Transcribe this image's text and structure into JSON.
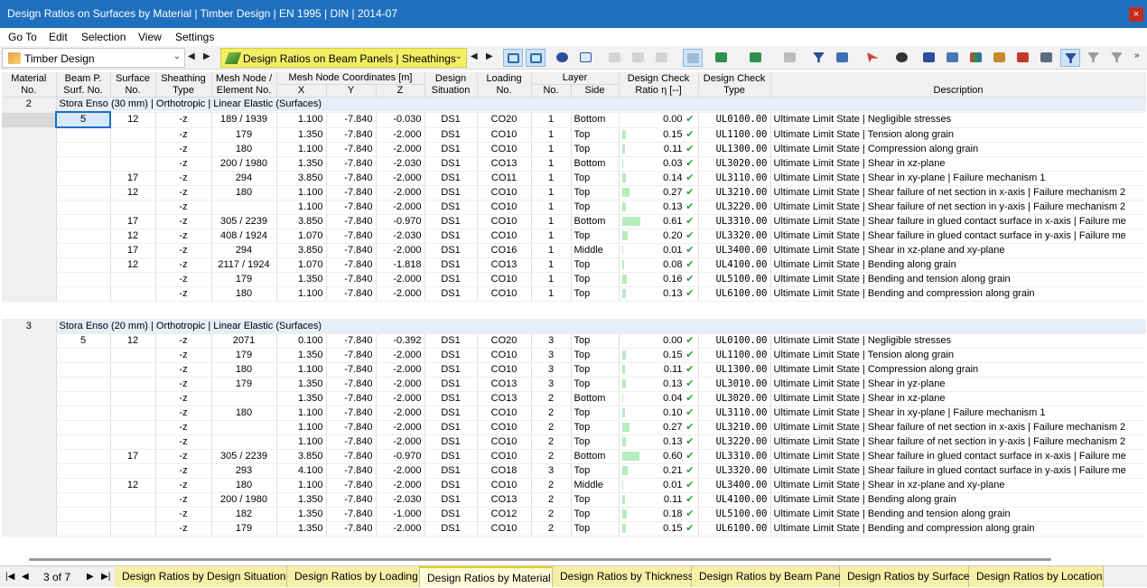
{
  "window": {
    "title": "Design Ratios on Surfaces by Material | Timber Design | EN 1995 | DIN | 2014-07",
    "close_label": "×"
  },
  "menu": [
    "Go To",
    "Edit",
    "Selection",
    "View",
    "Settings"
  ],
  "toolbar": {
    "module_combo": "Timber Design",
    "view_combo": "Design Ratios on Beam Panels | Sheathings",
    "icons": [
      "select-in-model-icon",
      "jump-to-object-icon",
      "view-visibility-icon",
      "xxx-values-icon",
      "table-1-icon",
      "table-2-icon",
      "table-3-icon",
      "align-icon",
      "export-excel-icon",
      "import-excel-icon",
      "print-icon",
      "filter-icon",
      "decimal-icon",
      "cursor-x-icon",
      "help-icon",
      "info-list-icon",
      "layers-icon",
      "color-scale-icon",
      "stack-icon",
      "diagram-icon",
      "relations-icon",
      "filter-active-icon",
      "filter-clear-icon",
      "filter-more-icon"
    ]
  },
  "headers": {
    "material_no": [
      "Material",
      "No."
    ],
    "beam_surf": [
      "Beam P.",
      "Surf. No."
    ],
    "surface_no": [
      "Surface",
      "No."
    ],
    "sheathing": [
      "Sheathing",
      "Type"
    ],
    "mesh": [
      "Mesh Node /",
      "Element No."
    ],
    "coords": "Mesh Node Coordinates [m]",
    "x": "X",
    "y": "Y",
    "z": "Z",
    "design_sit": [
      "Design",
      "Situation"
    ],
    "loading": [
      "Loading",
      "No."
    ],
    "layer": "Layer",
    "layer_no": "No.",
    "layer_side": "Side",
    "ratio": [
      "Design Check",
      "Ratio η [--]"
    ],
    "check_type": [
      "Design Check",
      "Type"
    ],
    "description": "Description"
  },
  "groups": [
    {
      "material": "2",
      "title": "Stora Enso (30 mm) | Orthotropic | Linear Elastic (Surfaces)",
      "rows": [
        {
          "beam": "5",
          "surf": "12",
          "sheath": "-z",
          "mesh": "189 / 1939",
          "x": "1.100",
          "y": "-7.840",
          "z": "-0.030",
          "ds": "DS1",
          "load": "CO20",
          "lno": "1",
          "side": "Bottom",
          "ratio": "0.00",
          "type": "UL0100.00",
          "desc": "Ultimate Limit State | Negligible stresses"
        },
        {
          "beam": "",
          "surf": "",
          "sheath": "-z",
          "mesh": "179",
          "x": "1.350",
          "y": "-7.840",
          "z": "-2.000",
          "ds": "DS1",
          "load": "CO10",
          "lno": "1",
          "side": "Top",
          "ratio": "0.15",
          "type": "UL1100.00",
          "desc": "Ultimate Limit State | Tension along grain"
        },
        {
          "beam": "",
          "surf": "",
          "sheath": "-z",
          "mesh": "180",
          "x": "1.100",
          "y": "-7.840",
          "z": "-2.000",
          "ds": "DS1",
          "load": "CO10",
          "lno": "1",
          "side": "Top",
          "ratio": "0.11",
          "type": "UL1300.00",
          "desc": "Ultimate Limit State | Compression along grain"
        },
        {
          "beam": "",
          "surf": "",
          "sheath": "-z",
          "mesh": "200 / 1980",
          "x": "1.350",
          "y": "-7.840",
          "z": "-2.030",
          "ds": "DS1",
          "load": "CO13",
          "lno": "1",
          "side": "Bottom",
          "ratio": "0.03",
          "type": "UL3020.00",
          "desc": "Ultimate Limit State | Shear in xz-plane"
        },
        {
          "beam": "",
          "surf": "17",
          "sheath": "-z",
          "mesh": "294",
          "x": "3.850",
          "y": "-7.840",
          "z": "-2.000",
          "ds": "DS1",
          "load": "CO11",
          "lno": "1",
          "side": "Top",
          "ratio": "0.14",
          "type": "UL3110.00",
          "desc": "Ultimate Limit State | Shear in xy-plane | Failure mechanism 1"
        },
        {
          "beam": "",
          "surf": "12",
          "sheath": "-z",
          "mesh": "180",
          "x": "1.100",
          "y": "-7.840",
          "z": "-2.000",
          "ds": "DS1",
          "load": "CO10",
          "lno": "1",
          "side": "Top",
          "ratio": "0.27",
          "type": "UL3210.00",
          "desc": "Ultimate Limit State | Shear failure of net section in x-axis | Failure mechanism 2"
        },
        {
          "beam": "",
          "surf": "",
          "sheath": "-z",
          "mesh": "",
          "x": "1.100",
          "y": "-7.840",
          "z": "-2.000",
          "ds": "DS1",
          "load": "CO10",
          "lno": "1",
          "side": "Top",
          "ratio": "0.13",
          "type": "UL3220.00",
          "desc": "Ultimate Limit State | Shear failure of net section in y-axis | Failure mechanism 2"
        },
        {
          "beam": "",
          "surf": "17",
          "sheath": "-z",
          "mesh": "305 / 2239",
          "x": "3.850",
          "y": "-7.840",
          "z": "-0.970",
          "ds": "DS1",
          "load": "CO10",
          "lno": "1",
          "side": "Bottom",
          "ratio": "0.61",
          "type": "UL3310.00",
          "desc": "Ultimate Limit State | Shear failure in glued contact surface in x-axis | Failure me"
        },
        {
          "beam": "",
          "surf": "12",
          "sheath": "-z",
          "mesh": "408 / 1924",
          "x": "1.070",
          "y": "-7.840",
          "z": "-2.030",
          "ds": "DS1",
          "load": "CO10",
          "lno": "1",
          "side": "Top",
          "ratio": "0.20",
          "type": "UL3320.00",
          "desc": "Ultimate Limit State | Shear failure in glued contact surface in y-axis | Failure me"
        },
        {
          "beam": "",
          "surf": "17",
          "sheath": "-z",
          "mesh": "294",
          "x": "3.850",
          "y": "-7.840",
          "z": "-2.000",
          "ds": "DS1",
          "load": "CO16",
          "lno": "1",
          "side": "Middle",
          "ratio": "0.01",
          "type": "UL3400.00",
          "desc": "Ultimate Limit State | Shear in xz-plane and xy-plane"
        },
        {
          "beam": "",
          "surf": "12",
          "sheath": "-z",
          "mesh": "2117 / 1924",
          "x": "1.070",
          "y": "-7.840",
          "z": "-1.818",
          "ds": "DS1",
          "load": "CO13",
          "lno": "1",
          "side": "Top",
          "ratio": "0.08",
          "type": "UL4100.00",
          "desc": "Ultimate Limit State | Bending along grain"
        },
        {
          "beam": "",
          "surf": "",
          "sheath": "-z",
          "mesh": "179",
          "x": "1.350",
          "y": "-7.840",
          "z": "-2.000",
          "ds": "DS1",
          "load": "CO10",
          "lno": "1",
          "side": "Top",
          "ratio": "0.16",
          "type": "UL5100.00",
          "desc": "Ultimate Limit State | Bending and tension along grain"
        },
        {
          "beam": "",
          "surf": "",
          "sheath": "-z",
          "mesh": "180",
          "x": "1.100",
          "y": "-7.840",
          "z": "-2.000",
          "ds": "DS1",
          "load": "CO10",
          "lno": "1",
          "side": "Top",
          "ratio": "0.13",
          "type": "UL6100.00",
          "desc": "Ultimate Limit State | Bending and compression along grain"
        }
      ]
    },
    {
      "material": "3",
      "title": "Stora Enso (20 mm) | Orthotropic | Linear Elastic (Surfaces)",
      "rows": [
        {
          "beam": "5",
          "surf": "12",
          "sheath": "-z",
          "mesh": "2071",
          "x": "0.100",
          "y": "-7.840",
          "z": "-0.392",
          "ds": "DS1",
          "load": "CO20",
          "lno": "3",
          "side": "Top",
          "ratio": "0.00",
          "type": "UL0100.00",
          "desc": "Ultimate Limit State | Negligible stresses"
        },
        {
          "beam": "",
          "surf": "",
          "sheath": "-z",
          "mesh": "179",
          "x": "1.350",
          "y": "-7.840",
          "z": "-2.000",
          "ds": "DS1",
          "load": "CO10",
          "lno": "3",
          "side": "Top",
          "ratio": "0.15",
          "type": "UL1100.00",
          "desc": "Ultimate Limit State | Tension along grain"
        },
        {
          "beam": "",
          "surf": "",
          "sheath": "-z",
          "mesh": "180",
          "x": "1.100",
          "y": "-7.840",
          "z": "-2.000",
          "ds": "DS1",
          "load": "CO10",
          "lno": "3",
          "side": "Top",
          "ratio": "0.11",
          "type": "UL1300.00",
          "desc": "Ultimate Limit State | Compression along grain"
        },
        {
          "beam": "",
          "surf": "",
          "sheath": "-z",
          "mesh": "179",
          "x": "1.350",
          "y": "-7.840",
          "z": "-2.000",
          "ds": "DS1",
          "load": "CO13",
          "lno": "3",
          "side": "Top",
          "ratio": "0.13",
          "type": "UL3010.00",
          "desc": "Ultimate Limit State | Shear in yz-plane"
        },
        {
          "beam": "",
          "surf": "",
          "sheath": "-z",
          "mesh": "",
          "x": "1.350",
          "y": "-7.840",
          "z": "-2.000",
          "ds": "DS1",
          "load": "CO13",
          "lno": "2",
          "side": "Bottom",
          "ratio": "0.04",
          "type": "UL3020.00",
          "desc": "Ultimate Limit State | Shear in xz-plane"
        },
        {
          "beam": "",
          "surf": "",
          "sheath": "-z",
          "mesh": "180",
          "x": "1.100",
          "y": "-7.840",
          "z": "-2.000",
          "ds": "DS1",
          "load": "CO10",
          "lno": "2",
          "side": "Top",
          "ratio": "0.10",
          "type": "UL3110.00",
          "desc": "Ultimate Limit State | Shear in xy-plane | Failure mechanism 1"
        },
        {
          "beam": "",
          "surf": "",
          "sheath": "-z",
          "mesh": "",
          "x": "1.100",
          "y": "-7.840",
          "z": "-2.000",
          "ds": "DS1",
          "load": "CO10",
          "lno": "2",
          "side": "Top",
          "ratio": "0.27",
          "type": "UL3210.00",
          "desc": "Ultimate Limit State | Shear failure of net section in x-axis | Failure mechanism 2"
        },
        {
          "beam": "",
          "surf": "",
          "sheath": "-z",
          "mesh": "",
          "x": "1.100",
          "y": "-7.840",
          "z": "-2.000",
          "ds": "DS1",
          "load": "CO10",
          "lno": "2",
          "side": "Top",
          "ratio": "0.13",
          "type": "UL3220.00",
          "desc": "Ultimate Limit State | Shear failure of net section in y-axis | Failure mechanism 2"
        },
        {
          "beam": "",
          "surf": "17",
          "sheath": "-z",
          "mesh": "305 / 2239",
          "x": "3.850",
          "y": "-7.840",
          "z": "-0.970",
          "ds": "DS1",
          "load": "CO10",
          "lno": "2",
          "side": "Bottom",
          "ratio": "0.60",
          "type": "UL3310.00",
          "desc": "Ultimate Limit State | Shear failure in glued contact surface in x-axis | Failure me"
        },
        {
          "beam": "",
          "surf": "",
          "sheath": "-z",
          "mesh": "293",
          "x": "4.100",
          "y": "-7.840",
          "z": "-2.000",
          "ds": "DS1",
          "load": "CO18",
          "lno": "3",
          "side": "Top",
          "ratio": "0.21",
          "type": "UL3320.00",
          "desc": "Ultimate Limit State | Shear failure in glued contact surface in y-axis | Failure me"
        },
        {
          "beam": "",
          "surf": "12",
          "sheath": "-z",
          "mesh": "180",
          "x": "1.100",
          "y": "-7.840",
          "z": "-2.000",
          "ds": "DS1",
          "load": "CO10",
          "lno": "2",
          "side": "Middle",
          "ratio": "0.01",
          "type": "UL3400.00",
          "desc": "Ultimate Limit State | Shear in xz-plane and xy-plane"
        },
        {
          "beam": "",
          "surf": "",
          "sheath": "-z",
          "mesh": "200 / 1980",
          "x": "1.350",
          "y": "-7.840",
          "z": "-2.030",
          "ds": "DS1",
          "load": "CO13",
          "lno": "2",
          "side": "Top",
          "ratio": "0.11",
          "type": "UL4100.00",
          "desc": "Ultimate Limit State | Bending along grain"
        },
        {
          "beam": "",
          "surf": "",
          "sheath": "-z",
          "mesh": "182",
          "x": "1.350",
          "y": "-7.840",
          "z": "-1.000",
          "ds": "DS1",
          "load": "CO12",
          "lno": "2",
          "side": "Top",
          "ratio": "0.18",
          "type": "UL5100.00",
          "desc": "Ultimate Limit State | Bending and tension along grain"
        },
        {
          "beam": "",
          "surf": "",
          "sheath": "-z",
          "mesh": "179",
          "x": "1.350",
          "y": "-7.840",
          "z": "-2.000",
          "ds": "DS1",
          "load": "CO10",
          "lno": "2",
          "side": "Top",
          "ratio": "0.15",
          "type": "UL6100.00",
          "desc": "Ultimate Limit State | Bending and compression along grain"
        }
      ]
    }
  ],
  "status": {
    "page": "3 of 7",
    "tabs": [
      {
        "label": "Design Ratios by Design Situation",
        "active": false
      },
      {
        "label": "Design Ratios by Loading",
        "active": false
      },
      {
        "label": "Design Ratios by Material",
        "active": true
      },
      {
        "label": "Design Ratios by Thickness",
        "active": false
      },
      {
        "label": "Design Ratios by Beam Panel",
        "active": false
      },
      {
        "label": "Design Ratios by Surface",
        "active": false
      },
      {
        "label": "Design Ratios by Location",
        "active": false
      }
    ]
  },
  "colors": {
    "titlebar": "#1f6fbf",
    "tab_bg": "#f5f0a8",
    "ratio_bar": "#b7ecbd",
    "check": "#2e9e3e",
    "group_row": "#e8eef7"
  }
}
